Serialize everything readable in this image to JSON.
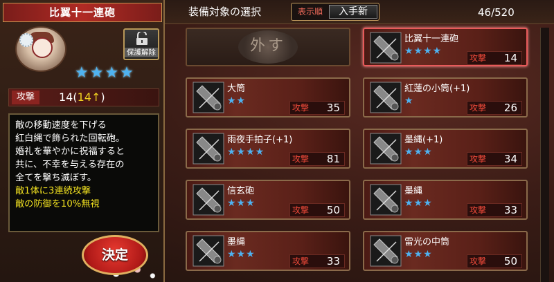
{
  "left": {
    "title": "比翼十一連砲",
    "protect_label": "保護解除",
    "stars": "★★★★",
    "attack_label": "攻撃",
    "attack_value": "14(",
    "attack_bonus": "14↑",
    "attack_close": ")",
    "description": [
      {
        "text": "敵の移動速度を下げる",
        "highlight": false
      },
      {
        "text": "紅白縄で飾られた回転砲。",
        "highlight": false
      },
      {
        "text": "婚礼を華やかに祝福すると",
        "highlight": false
      },
      {
        "text": "共に、不幸を与える存在の",
        "highlight": false
      },
      {
        "text": "全てを撃ち滅ぼす。",
        "highlight": false
      },
      {
        "text": "敵1体に3連続攻撃",
        "highlight": true
      },
      {
        "text": "敵の防御を10%無視",
        "highlight": true
      }
    ],
    "decide_label": "決定"
  },
  "header": {
    "title": "装備対象の選択",
    "sort_label": "表示順",
    "sort_value": "入手新",
    "count": "46/520"
  },
  "remove_label": "外す",
  "items": [
    {
      "name": "比翼十一連砲",
      "stars": "★★★★",
      "attack_label": "攻撃",
      "attack": "14",
      "selected": true
    },
    {
      "name": "大筒",
      "stars": "★★",
      "attack_label": "攻撃",
      "attack": "35"
    },
    {
      "name": "紅蓮の小筒(+1)",
      "stars": "★",
      "attack_label": "攻撃",
      "attack": "26"
    },
    {
      "name": "雨夜手拍子(+1)",
      "stars": "★★★★",
      "attack_label": "攻撃",
      "attack": "81"
    },
    {
      "name": "墨縄(+1)",
      "stars": "★★★",
      "attack_label": "攻撃",
      "attack": "34"
    },
    {
      "name": "信玄砲",
      "stars": "★★★",
      "attack_label": "攻撃",
      "attack": "50"
    },
    {
      "name": "墨縄",
      "stars": "★★★",
      "attack_label": "攻撃",
      "attack": "33"
    },
    {
      "name": "墨縄",
      "stars": "★★★",
      "attack_label": "攻撃",
      "attack": "33"
    },
    {
      "name": "雷光の中筒",
      "stars": "★★★",
      "attack_label": "攻撃",
      "attack": "50"
    }
  ],
  "colors": {
    "star": "#4fb2f0",
    "highlight": "#f0e020",
    "attack_label": "#f04a3a",
    "accent_red": "#b02a24"
  }
}
